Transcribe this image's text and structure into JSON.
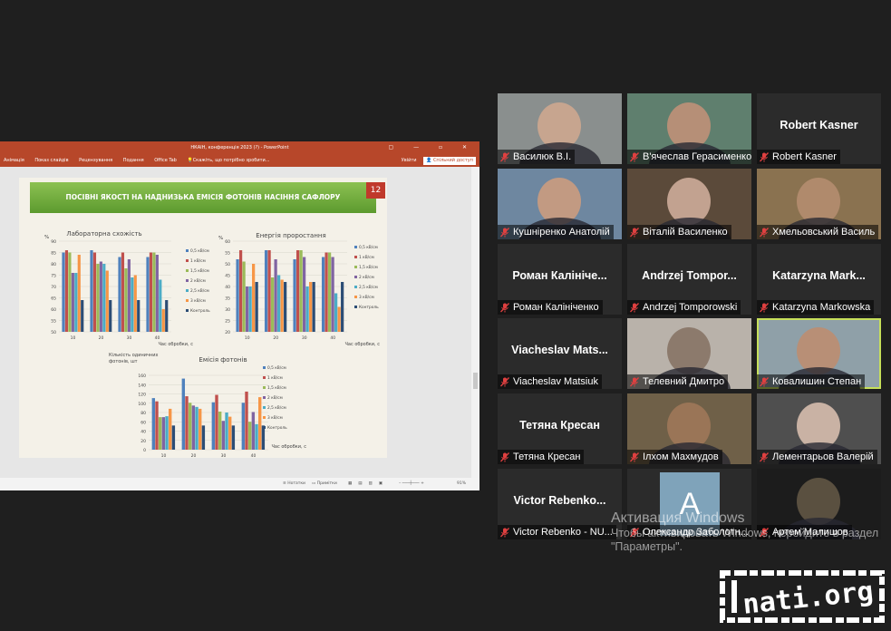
{
  "ppt": {
    "title": "НКАІН, конференція 2023 (?) - PowerPoint",
    "ribbon_tabs": [
      "Анімація",
      "Показ слайдів",
      "Рецензування",
      "Подання",
      "Office Tab"
    ],
    "tell_me": "Скажіть, що потрібно зробити...",
    "login": "Увійти",
    "share": "Спільний доступ",
    "status_notes": "Нотатки",
    "status_comments": "Примітки",
    "zoom": "91%"
  },
  "slide": {
    "title": "ПОСІВНІ ЯКОСТІ НА НАДНИЗЬКА ЕМІСІЯ ФОТОНІВ НАСІННЯ САФЛОРУ",
    "number": "12"
  },
  "chart_data": [
    {
      "type": "bar",
      "title": "Лабораторна схожість",
      "ylabel": "%",
      "xlabel": "Час обробки, с",
      "categories": [
        "10",
        "20",
        "30",
        "40"
      ],
      "ylim": [
        50,
        90
      ],
      "yticks": [
        "50",
        "55",
        "60",
        "65",
        "70",
        "75",
        "80",
        "85",
        "90"
      ],
      "series": [
        {
          "name": "0,5 кВ/см",
          "color": "#4f81bd",
          "values": [
            85,
            86,
            83,
            83
          ]
        },
        {
          "name": "1 кВ/см",
          "color": "#c0504d",
          "values": [
            86,
            85,
            85,
            85
          ]
        },
        {
          "name": "1,5 кВ/см",
          "color": "#9bbb59",
          "values": [
            85,
            80,
            78,
            85
          ]
        },
        {
          "name": "2 кВ/см",
          "color": "#8064a2",
          "values": [
            76,
            81,
            82,
            84
          ]
        },
        {
          "name": "2,5 кВ/см",
          "color": "#4bacc6",
          "values": [
            76,
            80,
            74,
            73
          ]
        },
        {
          "name": "3 кВ/см",
          "color": "#f79646",
          "values": [
            84,
            77,
            75,
            60
          ]
        },
        {
          "name": "Контроль",
          "color": "#2c4d75",
          "values": [
            64,
            64,
            64,
            64
          ]
        }
      ]
    },
    {
      "type": "bar",
      "title": "Енергія проростання",
      "ylabel": "%",
      "xlabel": "Час обробки, с",
      "categories": [
        "10",
        "20",
        "30",
        "40"
      ],
      "ylim": [
        20,
        60
      ],
      "yticks": [
        "20",
        "25",
        "30",
        "35",
        "40",
        "45",
        "50",
        "55",
        "60"
      ],
      "series": [
        {
          "name": "0,5 кВ/см",
          "color": "#4f81bd",
          "values": [
            52,
            56,
            52,
            53
          ]
        },
        {
          "name": "1 кВ/см",
          "color": "#c0504d",
          "values": [
            56,
            56,
            56,
            55
          ]
        },
        {
          "name": "1,5 кВ/см",
          "color": "#9bbb59",
          "values": [
            51,
            44,
            56,
            55
          ]
        },
        {
          "name": "2 кВ/см",
          "color": "#8064a2",
          "values": [
            40,
            52,
            53,
            53
          ]
        },
        {
          "name": "2,5 кВ/см",
          "color": "#4bacc6",
          "values": [
            40,
            45,
            40,
            37
          ]
        },
        {
          "name": "3 кВ/см",
          "color": "#f79646",
          "values": [
            50,
            43,
            42,
            31
          ]
        },
        {
          "name": "Контроль",
          "color": "#2c4d75",
          "values": [
            42,
            42,
            42,
            42
          ]
        }
      ]
    },
    {
      "type": "bar",
      "title": "Емісія фотонів",
      "ylabel": "Кількість одиничних фотонів, шт",
      "xlabel": "Час обробки, с",
      "categories": [
        "10",
        "20",
        "30",
        "40"
      ],
      "ylim": [
        0,
        160
      ],
      "yticks": [
        "0",
        "20",
        "40",
        "60",
        "80",
        "100",
        "120",
        "140",
        "160"
      ],
      "series": [
        {
          "name": "0,5 кВ/см",
          "color": "#4f81bd",
          "values": [
            111,
            153,
            102,
            101
          ]
        },
        {
          "name": "1 кВ/см",
          "color": "#c0504d",
          "values": [
            104,
            115,
            118,
            125
          ]
        },
        {
          "name": "1,5 кВ/см",
          "color": "#9bbb59",
          "values": [
            70,
            101,
            82,
            60
          ]
        },
        {
          "name": "2 кВ/см",
          "color": "#8064a2",
          "values": [
            70,
            95,
            62,
            81
          ]
        },
        {
          "name": "2,5 кВ/см",
          "color": "#4bacc6",
          "values": [
            72,
            92,
            80,
            55
          ]
        },
        {
          "name": "3 кВ/см",
          "color": "#f79646",
          "values": [
            88,
            88,
            71,
            113
          ]
        },
        {
          "name": "Контроль",
          "color": "#2c4d75",
          "values": [
            52,
            52,
            52,
            52
          ]
        }
      ]
    }
  ],
  "participants": [
    {
      "big": "",
      "label": "Василюк В.І.",
      "video": true,
      "bg": "#8a8f8e",
      "face": "#c7a58f"
    },
    {
      "big": "",
      "label": "В'ячеслав Герасименко",
      "video": true,
      "bg": "#5f7f6e",
      "face": "#b68f77"
    },
    {
      "big": "Robert Kasner",
      "label": "Robert Kasner",
      "video": false
    },
    {
      "big": "",
      "label": "Кушніренко Анатолій",
      "video": true,
      "bg": "#6e87a0",
      "face": "#c29a82"
    },
    {
      "big": "",
      "label": "Віталій Василенко",
      "video": true,
      "bg": "#5b4a3a",
      "face": "#c2a290"
    },
    {
      "big": "",
      "label": "Хмельовський Василь",
      "video": true,
      "bg": "#8a7250",
      "face": "#b08a6c"
    },
    {
      "big": "Роман Калініче...",
      "label": "Роман Калініченко",
      "video": false
    },
    {
      "big": "Andrzej Tompor...",
      "label": "Andrzej Tomporowski",
      "video": false
    },
    {
      "big": "Katarzyna Mark...",
      "label": "Katarzyna Markowska",
      "video": false
    },
    {
      "big": "Viacheslav Mats...",
      "label": "Viacheslav Matsiuk",
      "video": false
    },
    {
      "big": "",
      "label": "Телевний Дмитро",
      "video": true,
      "bg": "#b9b2aa",
      "face": "#8c7a6c"
    },
    {
      "big": "",
      "label": "Ковалишин Степан",
      "video": true,
      "bg": "#8fa0a8",
      "face": "#b88f76",
      "active": true
    },
    {
      "big": "Тетяна Кресан",
      "label": "Тетяна Кресан",
      "video": false
    },
    {
      "big": "",
      "label": "Ілхом Махмудов",
      "video": true,
      "bg": "#6f6048",
      "face": "#9a7557"
    },
    {
      "big": "",
      "label": "Лементарьов Валерій",
      "video": true,
      "bg": "#4f4f4f",
      "face": "#c9b2a4"
    },
    {
      "big": "Victor Rebenko...",
      "label": "Victor Rebenko - NU...",
      "video": false
    },
    {
      "big": "",
      "label": "Олександр Заболотн...",
      "video": false,
      "avatar": "A"
    },
    {
      "big": "",
      "label": "Артем Малишов",
      "video": true,
      "bg": "#1c1c1c",
      "face": "#5a5040"
    }
  ],
  "activation": {
    "title": "Активация Windows",
    "subtitle": "Чтобы активировать Windows, перейдите в раздел \"Параметры\"."
  },
  "logo": {
    "text": "nati.org.ua"
  }
}
